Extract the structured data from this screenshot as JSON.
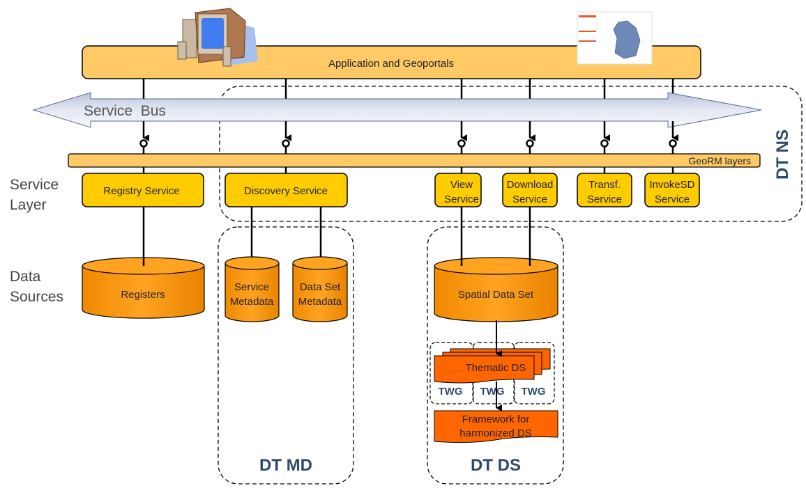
{
  "app_bar": {
    "label": "Application and Geoportals"
  },
  "service_bus": {
    "label": "Service  Bus"
  },
  "georm": {
    "label": "GeoRM layers"
  },
  "side_labels": {
    "service_layer": [
      "Service",
      "Layer"
    ],
    "data_sources": [
      "Data",
      "Sources"
    ]
  },
  "services": {
    "registry": [
      "Registry Service"
    ],
    "discovery": [
      "Discovery Service"
    ],
    "view": [
      "View",
      "Service"
    ],
    "download": [
      "Download",
      "Service"
    ],
    "transf": [
      "Transf.",
      "Service"
    ],
    "invokesd": [
      "InvokeSD",
      "Service"
    ]
  },
  "data_stores": {
    "registers": [
      "Registers"
    ],
    "service_metadata": [
      "Service",
      "Metadata"
    ],
    "dataset_metadata": [
      "Data Set",
      "Metadata"
    ],
    "spatial": [
      "Spatial Data Set"
    ]
  },
  "thematic": {
    "label": "Thematic DS",
    "twg": [
      "TWG",
      "TWG",
      "TWG"
    ]
  },
  "framework": [
    "Framework for",
    "harmonized DS"
  ],
  "groups": {
    "dt_ns": "DT NS",
    "dt_md": "DT MD",
    "dt_ds": "DT DS"
  },
  "colors": {
    "app_bar": "#FFC966",
    "service": "#FFCC00",
    "store": "#FF9900",
    "thematic": "#FF6600",
    "group_label": "#2E4A6B"
  },
  "icons": {
    "computer": "desktop-computer-icon",
    "map": "geoportal-map-screenshot"
  }
}
